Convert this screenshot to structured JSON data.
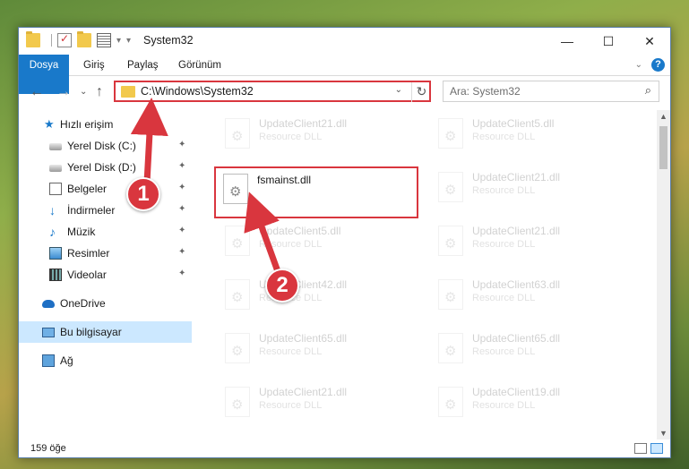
{
  "window": {
    "title": "System32",
    "minimize": "—",
    "maximize": "☐",
    "close": "✕"
  },
  "ribbon": {
    "tabs": [
      "Dosya",
      "Giriş",
      "Paylaş",
      "Görünüm"
    ],
    "expand_glyph": "⌄",
    "help": "?"
  },
  "nav": {
    "back": "←",
    "forward": "→",
    "recent": "⌄",
    "up": "↑",
    "address": "C:\\Windows\\System32",
    "address_dropdown": "⌄",
    "refresh": "↻"
  },
  "search": {
    "placeholder": "Ara: System32",
    "icon": "⌕"
  },
  "sidebar": {
    "items": [
      {
        "label": "Hızlı erişim",
        "icon": "star-icon"
      },
      {
        "label": "Yerel Disk (C:)",
        "icon": "disk-icon",
        "pinned": true
      },
      {
        "label": "Yerel Disk (D:)",
        "icon": "disk-icon",
        "pinned": true
      },
      {
        "label": "Belgeler",
        "icon": "document-icon",
        "pinned": true
      },
      {
        "label": "İndirmeler",
        "icon": "download-icon",
        "pinned": true
      },
      {
        "label": "Müzik",
        "icon": "music-icon",
        "pinned": true
      },
      {
        "label": "Resimler",
        "icon": "picture-icon",
        "pinned": true
      },
      {
        "label": "Videolar",
        "icon": "video-icon",
        "pinned": true
      },
      {
        "label": "OneDrive",
        "icon": "cloud-icon"
      },
      {
        "label": "Bu bilgisayar",
        "icon": "computer-icon",
        "selected": true
      },
      {
        "label": "Ağ",
        "icon": "network-icon"
      }
    ],
    "pin_glyph": "📌"
  },
  "files": {
    "left_column": [
      {
        "name": "UpdateClient21.dll",
        "type": "Resource DLL"
      },
      {
        "name": "fsmainst.dll",
        "type": ""
      },
      {
        "name": "UpdateClient5.dll",
        "type": "Resource DLL"
      },
      {
        "name": "UpdateClient42.dll",
        "type": "Resource DLL"
      },
      {
        "name": "UpdateClient65.dll",
        "type": "Resource DLL"
      },
      {
        "name": "UpdateClient21.dll",
        "type": "Resource DLL"
      }
    ],
    "right_column": [
      {
        "name": "UpdateClient5.dll",
        "type": "Resource DLL"
      },
      {
        "name": "UpdateClient21.dll",
        "type": "Resource DLL"
      },
      {
        "name": "UpdateClient21.dll",
        "type": "Resource DLL"
      },
      {
        "name": "UpdateClient63.dll",
        "type": "Resource DLL"
      },
      {
        "name": "UpdateClient65.dll",
        "type": "Resource DLL"
      },
      {
        "name": "UpdateClient19.dll",
        "type": "Resource DLL"
      }
    ]
  },
  "status": {
    "item_count": "159 öğe"
  },
  "annotations": {
    "step1": "1",
    "step2": "2",
    "color": "#d9363e"
  }
}
